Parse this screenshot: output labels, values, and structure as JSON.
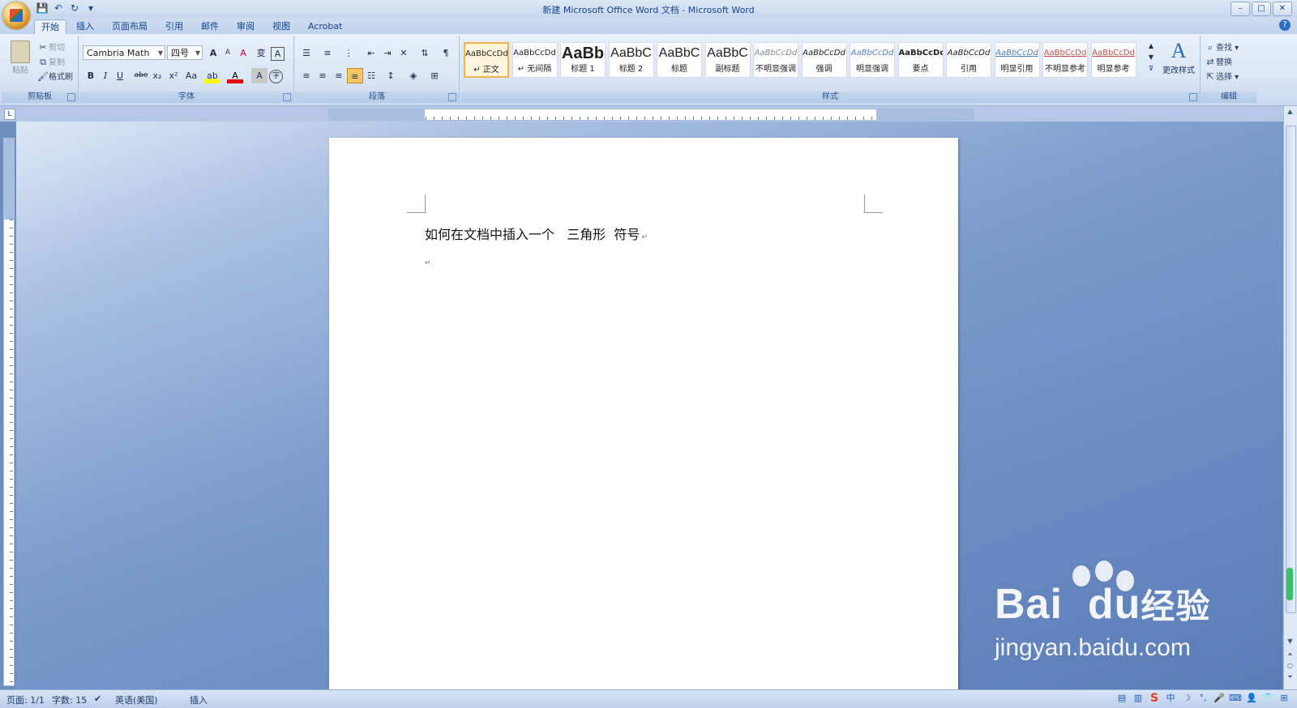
{
  "window": {
    "title": "新建 Microsoft Office Word 文档 - Microsoft Word",
    "controls": [
      "–",
      "□",
      "✕"
    ]
  },
  "quick_access": {
    "save": "💾",
    "undo": "↶",
    "redo": "↻",
    "more": "▾"
  },
  "tabs": [
    {
      "label": "开始",
      "active": true
    },
    {
      "label": "插入"
    },
    {
      "label": "页面布局"
    },
    {
      "label": "引用"
    },
    {
      "label": "邮件"
    },
    {
      "label": "审阅"
    },
    {
      "label": "视图"
    },
    {
      "label": "Acrobat"
    }
  ],
  "ribbon": {
    "clipboard": {
      "label": "剪贴板",
      "paste": "粘贴",
      "cut": "剪切",
      "copy": "复制",
      "format_painter": "格式刷"
    },
    "font": {
      "label": "字体",
      "font_name": "Cambria Math",
      "font_size": "四号",
      "bold": "B",
      "italic": "I",
      "underline": "U",
      "strike": "abe",
      "sub": "x₂",
      "sup": "x²",
      "case": "Aa",
      "grow": "A",
      "shrink": "A",
      "clear": "A",
      "phonetic": "变",
      "border": "A",
      "highlight": "ab",
      "color": "A",
      "shade": "A",
      "enclose": "字"
    },
    "paragraph": {
      "label": "段落"
    },
    "styles": {
      "label": "样式",
      "change_styles": "更改样式",
      "items": [
        {
          "sample": "AaBbCcDd",
          "name": "↵ 正文",
          "selected": true
        },
        {
          "sample": "AaBbCcDd",
          "name": "↵ 无间隔"
        },
        {
          "sample": "AaBb",
          "name": "标题 1"
        },
        {
          "sample": "AaBbC",
          "name": "标题 2"
        },
        {
          "sample": "AaBbC",
          "name": "标题"
        },
        {
          "sample": "AaBbC",
          "name": "副标题"
        },
        {
          "sample": "AaBbCcDd",
          "name": "不明显强调"
        },
        {
          "sample": "AaBbCcDd",
          "name": "强调"
        },
        {
          "sample": "AaBbCcDd",
          "name": "明显强调"
        },
        {
          "sample": "AaBbCcDd",
          "name": "要点"
        },
        {
          "sample": "AaBbCcDd",
          "name": "引用"
        },
        {
          "sample": "AaBbCcDd",
          "name": "明显引用"
        },
        {
          "sample": "AaBbCcDd",
          "name": "不明显参考"
        },
        {
          "sample": "AaBbCcDd",
          "name": "明显参考"
        }
      ]
    },
    "editing": {
      "label": "编辑",
      "find": "查找",
      "replace": "替换",
      "select": "选择"
    }
  },
  "document": {
    "line1": "如何在文档中插入一个   三角形  符号",
    "para_mark": "↵"
  },
  "statusbar": {
    "page": "页面: 1/1",
    "words": "字数: 15",
    "language": "英语(美国)",
    "mode": "插入"
  },
  "watermark": {
    "brand": "Bai  du",
    "brand_cn": "经验",
    "url": "jingyan.baidu.com"
  }
}
